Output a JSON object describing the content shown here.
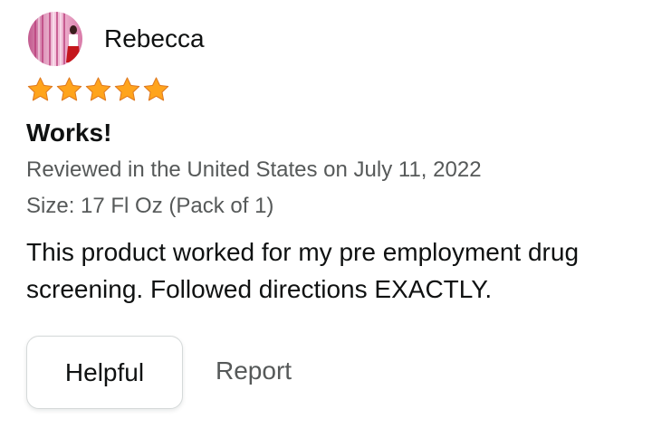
{
  "reviewer": {
    "name": "Rebecca"
  },
  "rating": {
    "stars": 5,
    "max": 5,
    "color": "#ffa41c"
  },
  "review": {
    "title": "Works!",
    "date_line": "Reviewed in the United States on July 11, 2022",
    "size_line": "Size: 17 Fl Oz (Pack of 1)",
    "body": "This product worked for my pre employment drug screening. Followed directions EXACTLY."
  },
  "actions": {
    "helpful_label": "Helpful",
    "report_label": "Report"
  },
  "icons": {
    "avatar": "profile-avatar",
    "star": "star-icon"
  }
}
